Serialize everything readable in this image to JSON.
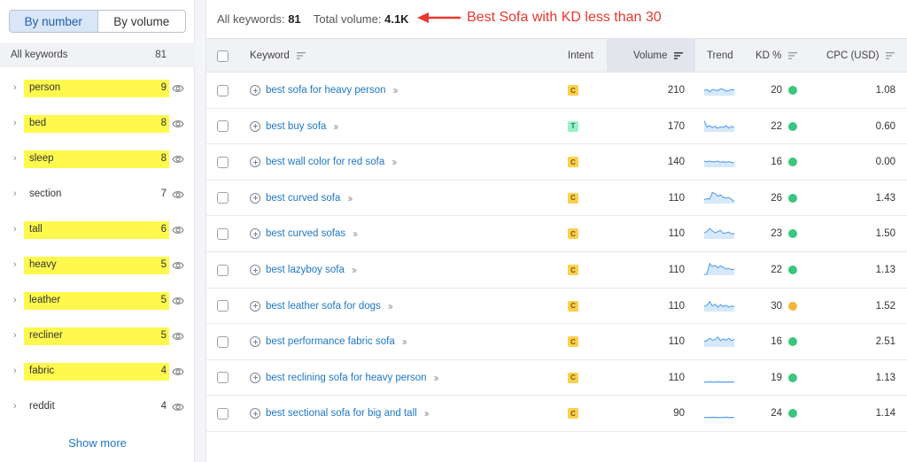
{
  "sidebar": {
    "toggle": {
      "by_number": "By number",
      "by_volume": "By volume"
    },
    "all_keywords": {
      "label": "All keywords",
      "count": "81"
    },
    "groups": [
      {
        "label": "person",
        "count": "9",
        "highlighted": true
      },
      {
        "label": "bed",
        "count": "8",
        "highlighted": true
      },
      {
        "label": "sleep",
        "count": "8",
        "highlighted": true
      },
      {
        "label": "section",
        "count": "7",
        "highlighted": false
      },
      {
        "label": "tall",
        "count": "6",
        "highlighted": true
      },
      {
        "label": "heavy",
        "count": "5",
        "highlighted": true
      },
      {
        "label": "leather",
        "count": "5",
        "highlighted": true
      },
      {
        "label": "recliner",
        "count": "5",
        "highlighted": true
      },
      {
        "label": "fabric",
        "count": "4",
        "highlighted": true
      },
      {
        "label": "reddit",
        "count": "4",
        "highlighted": false
      }
    ],
    "show_more": "Show more"
  },
  "summary": {
    "all_keywords_label": "All keywords:",
    "all_keywords_value": "81",
    "total_volume_label": "Total volume:",
    "total_volume_value": "4.1K"
  },
  "annotation": {
    "text": "Best Sofa with KD less than 30",
    "color": "#e8382e"
  },
  "table": {
    "headers": {
      "keyword": "Keyword",
      "intent": "Intent",
      "volume": "Volume",
      "trend": "Trend",
      "kd": "KD %",
      "cpc": "CPC (USD)"
    },
    "rows": [
      {
        "keyword": "best sofa for heavy person",
        "intent": "C",
        "volume": "210",
        "kd": "20",
        "kd_color": "#3ac67f",
        "cpc": "1.08",
        "trend": [
          0.4,
          0.5,
          0.3,
          0.5,
          0.45,
          0.4,
          0.55,
          0.5,
          0.35,
          0.4,
          0.5,
          0.45
        ]
      },
      {
        "keyword": "best buy sofa",
        "intent": "T",
        "volume": "170",
        "kd": "22",
        "kd_color": "#3ac67f",
        "cpc": "0.60",
        "trend": [
          0.9,
          0.4,
          0.5,
          0.35,
          0.45,
          0.3,
          0.4,
          0.35,
          0.5,
          0.3,
          0.45,
          0.35
        ]
      },
      {
        "keyword": "best wall color for red sofa",
        "intent": "C",
        "volume": "140",
        "kd": "16",
        "kd_color": "#3ac67f",
        "cpc": "0.00",
        "trend": [
          0.5,
          0.45,
          0.5,
          0.45,
          0.45,
          0.5,
          0.4,
          0.45,
          0.4,
          0.45,
          0.4,
          0.35
        ]
      },
      {
        "keyword": "best curved sofa",
        "intent": "C",
        "volume": "110",
        "kd": "26",
        "kd_color": "#3ac67f",
        "cpc": "1.43",
        "trend": [
          0.3,
          0.4,
          0.35,
          0.9,
          0.8,
          0.6,
          0.7,
          0.5,
          0.45,
          0.5,
          0.35,
          0.15
        ]
      },
      {
        "keyword": "best curved sofas",
        "intent": "C",
        "volume": "110",
        "kd": "23",
        "kd_color": "#3ac67f",
        "cpc": "1.50",
        "trend": [
          0.5,
          0.6,
          0.85,
          0.65,
          0.5,
          0.6,
          0.7,
          0.45,
          0.5,
          0.55,
          0.4,
          0.45
        ]
      },
      {
        "keyword": "best lazyboy sofa",
        "intent": "C",
        "volume": "110",
        "kd": "22",
        "kd_color": "#3ac67f",
        "cpc": "1.13",
        "trend": [
          0.05,
          0.1,
          0.95,
          0.7,
          0.8,
          0.6,
          0.75,
          0.65,
          0.5,
          0.55,
          0.45,
          0.5
        ]
      },
      {
        "keyword": "best leather sofa for dogs",
        "intent": "C",
        "volume": "110",
        "kd": "30",
        "kd_color": "#f4b73c",
        "cpc": "1.52",
        "trend": [
          0.4,
          0.5,
          0.8,
          0.45,
          0.6,
          0.35,
          0.55,
          0.4,
          0.5,
          0.35,
          0.45,
          0.4
        ]
      },
      {
        "keyword": "best performance fabric sofa",
        "intent": "C",
        "volume": "110",
        "kd": "16",
        "kd_color": "#3ac67f",
        "cpc": "2.51",
        "trend": [
          0.45,
          0.5,
          0.7,
          0.55,
          0.6,
          0.8,
          0.5,
          0.65,
          0.55,
          0.7,
          0.5,
          0.6
        ]
      },
      {
        "keyword": "best reclining sofa for heavy person",
        "intent": "C",
        "volume": "110",
        "kd": "19",
        "kd_color": "#3ac67f",
        "cpc": "1.13",
        "trend": [
          0.1,
          0.1,
          0.12,
          0.1,
          0.1,
          0.12,
          0.1,
          0.1,
          0.1,
          0.12,
          0.1,
          0.1
        ]
      },
      {
        "keyword": "best sectional sofa for big and tall",
        "intent": "C",
        "volume": "90",
        "kd": "24",
        "kd_color": "#3ac67f",
        "cpc": "1.14",
        "trend": [
          0.1,
          0.1,
          0.1,
          0.12,
          0.1,
          0.1,
          0.1,
          0.1,
          0.12,
          0.1,
          0.1,
          0.1
        ]
      }
    ]
  }
}
